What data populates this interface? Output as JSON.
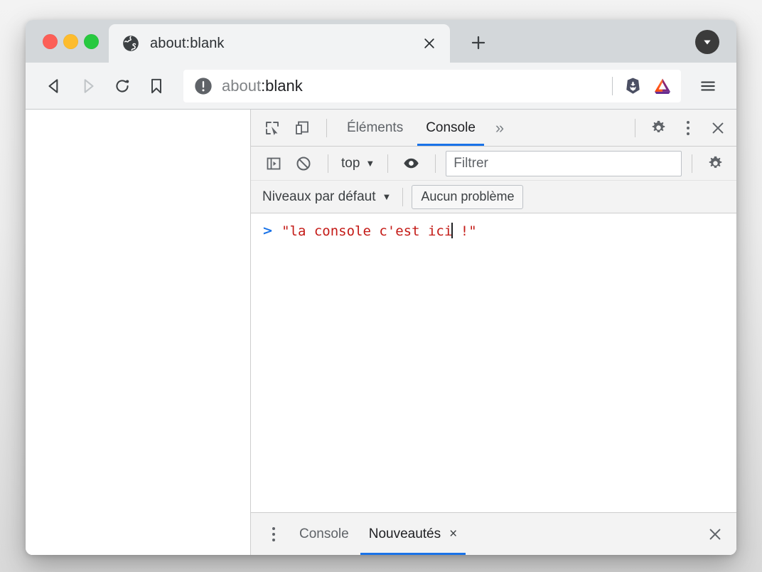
{
  "window": {
    "traffic_lights": [
      "close",
      "minimize",
      "zoom"
    ],
    "colors": {
      "red": "#fc5f57",
      "yellow": "#fdbc2d",
      "green": "#27c93f",
      "tabstrip_bg": "#d3d7da",
      "toolbar_bg": "#f2f3f4",
      "devtools_bg": "#f3f3f3",
      "accent_blue": "#1a73e8",
      "string_red": "#c41a16"
    }
  },
  "tab": {
    "title": "about:blank",
    "favicon": "globe-icon",
    "close_label": "×"
  },
  "tabstrip": {
    "new_tab_label": "+",
    "tab_list_label": "▼"
  },
  "nav": {
    "back": "back-arrow",
    "forward": "forward-arrow",
    "reload": "reload-icon",
    "bookmark": "bookmark-icon",
    "menu": "hamburger-menu"
  },
  "url_bar": {
    "security_icon": "info-circle-icon",
    "scheme": "about",
    "rest": ":blank",
    "full": "about:blank",
    "brave_shield": "brave-lion-icon",
    "bat_rewards": "bat-triangle-icon"
  },
  "devtools": {
    "toolbar_icons": {
      "inspect": "inspect-element-icon",
      "device": "device-toolbar-icon",
      "settings": "gear-icon",
      "more": "kebab-menu-icon",
      "close": "close-icon"
    },
    "tabs": [
      {
        "label": "Éléments",
        "active": false
      },
      {
        "label": "Console",
        "active": true
      }
    ],
    "more_tabs_label": "»",
    "console_toolbar": {
      "sidebar_icon": "console-sidebar-icon",
      "clear_icon": "clear-console-icon",
      "context": "top",
      "context_caret": "▼",
      "eye_icon": "live-expression-icon",
      "filter_placeholder": "Filtrer",
      "filter_value": "",
      "settings_icon": "gear-icon"
    },
    "console_toolbar2": {
      "levels_label": "Niveaux par défaut",
      "levels_caret": "▼",
      "issues_label": "Aucun problème"
    },
    "console_output": [
      {
        "prompt": ">",
        "before_caret": "\"la console c'est ici",
        "after_caret": " !\""
      }
    ],
    "drawer": {
      "menu_icon": "kebab-menu-icon",
      "tabs": [
        {
          "label": "Console",
          "active": false,
          "closable": false
        },
        {
          "label": "Nouveautés",
          "active": true,
          "closable": true,
          "close_label": "×"
        }
      ],
      "close_label": "close-drawer-icon"
    }
  }
}
